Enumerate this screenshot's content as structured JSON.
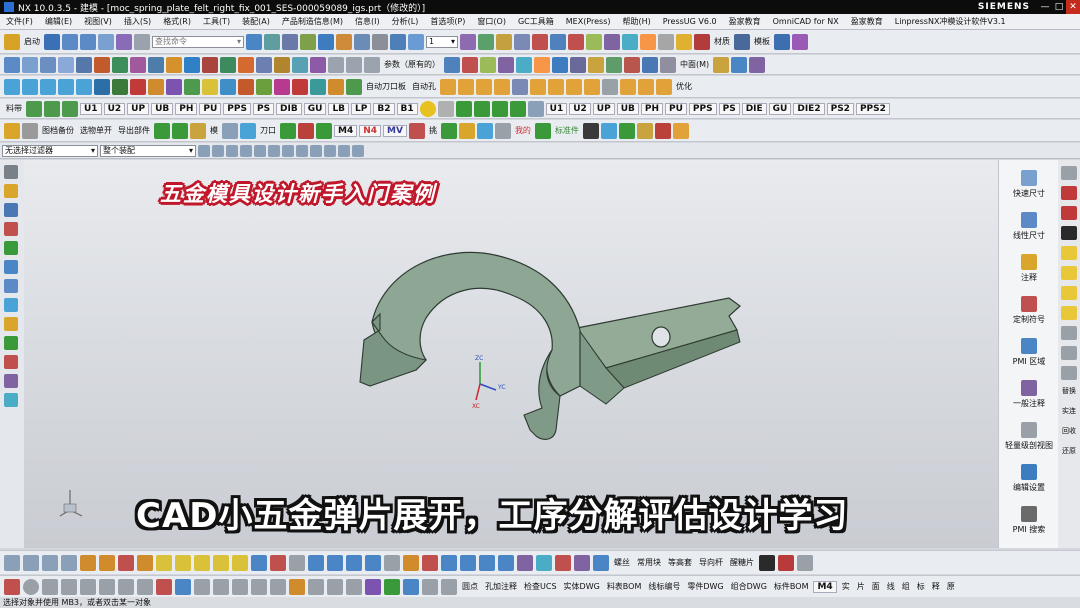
{
  "window": {
    "title": "NX 10.0.3.5 - 建模 - [moc_spring_plate_felt_right_fix_001_SES-000059089_igs.prt（修改的）]",
    "brand": "SIEMENS",
    "min": "—",
    "max": "□",
    "close": "✕"
  },
  "menus": [
    "文件(F)",
    "编辑(E)",
    "视图(V)",
    "插入(S)",
    "格式(R)",
    "工具(T)",
    "装配(A)",
    "产品制造信息(M)",
    "信息(I)",
    "分析(L)",
    "首选项(P)",
    "窗口(O)",
    "GC工具箱",
    "MEX(Press)",
    "帮助(H)",
    "PressUG V6.0",
    "盈家教育",
    "OmniCAD for NX",
    "盈家教育",
    "LinpressNX冲模设计软件V3.1"
  ],
  "toolbar1": {
    "start_label": "启动",
    "command_search_placeholder": "查找命令",
    "layer_value": "1",
    "material_label": "材质",
    "template_label": "模板"
  },
  "toolbar2": {
    "params_label": "参数（原有的）",
    "align_label": "中面(M)"
  },
  "toolbar3": {
    "auto_punch_label": "自动刀口板",
    "auto_hole_label": "自动孔",
    "optimize_label": "优化"
  },
  "toolbar4": {
    "material_label": "料带",
    "cad_buttons": [
      "U1",
      "U2",
      "UP",
      "UB",
      "PH",
      "PU",
      "PPS",
      "PS",
      "DIB",
      "GU",
      "LB",
      "LP",
      "B2",
      "B1"
    ],
    "right_buttons": [
      "U1",
      "U2",
      "UP",
      "UB",
      "PH",
      "PU",
      "PPS",
      "PS",
      "DIE",
      "GU",
      "DIE2",
      "PS2",
      "PPS2"
    ]
  },
  "toolbar5": {
    "labels": [
      "图档备份",
      "选物单开",
      "导出部件",
      "模",
      "刀口",
      "M4",
      "N4",
      "MV",
      "挑",
      "我的",
      "标准件"
    ]
  },
  "selection": {
    "filter_value": "无选择过滤器",
    "scope_value": "整个装配"
  },
  "right_panel": [
    "快速尺寸",
    "线性尺寸",
    "注释",
    "定制符号",
    "PMI 区域",
    "一般注释",
    "轻量级剖视图",
    "编辑设置",
    "PMI 搜索"
  ],
  "far_right": [
    "替换",
    "实连",
    "回收",
    "还原"
  ],
  "bottom_toolbar1": {
    "labels": [
      "螺丝",
      "常用块",
      "等高套",
      "导向杆",
      "醒糖片"
    ]
  },
  "bottom_toolbar2": {
    "labels": [
      "圆点",
      "孔加注释",
      "检查UCS",
      "实体DWG",
      "料表BOM",
      "线标编号",
      "零件DWG",
      "组合DWG",
      "标件BOM",
      "M4",
      "实",
      "片",
      "面",
      "线",
      "组",
      "标",
      "释",
      "原"
    ]
  },
  "status_text": "选择对象并使用 MB3，或者双击某一对象",
  "caption_top": "五金模具设计新手入门案例",
  "caption_bottom": "CAD小五金弹片展开，工序分解评估设计学习",
  "axis_labels": {
    "x": "XC",
    "y": "YC",
    "z": "ZC"
  },
  "colors": {
    "part_face": "#7f9a86",
    "part_edge": "#2e3a31",
    "caption_top_outline": "#c0172a",
    "caption_bottom_outline": "#111111"
  }
}
